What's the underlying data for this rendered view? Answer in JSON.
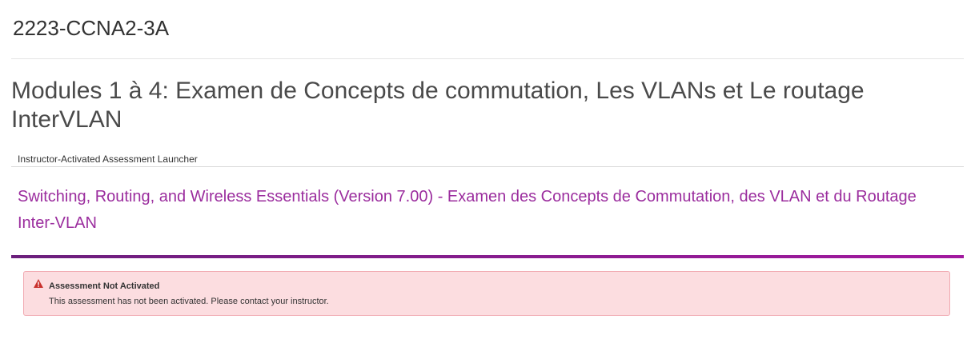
{
  "course": {
    "title": "2223-CCNA2-3A"
  },
  "assessment": {
    "title": "Modules 1 à 4: Examen de Concepts de commutation, Les VLANs et Le routage InterVLAN",
    "launcher_label": "Instructor-Activated Assessment Launcher",
    "activity_link": "Switching, Routing, and Wireless Essentials (Version 7.00) - Examen des Concepts de Commutation, des VLAN et du Routage Inter-VLAN"
  },
  "alert": {
    "icon": "warning-icon",
    "heading": "Assessment Not Activated",
    "message": "This assessment has not been activated. Please contact your instructor."
  },
  "colors": {
    "link": "#9b2d9e",
    "accent_bar_start": "#6b1f7c",
    "accent_bar_end": "#a2199f",
    "alert_background": "#fcdde0",
    "alert_border": "#f1aab2",
    "warning_icon": "#c9302c"
  }
}
